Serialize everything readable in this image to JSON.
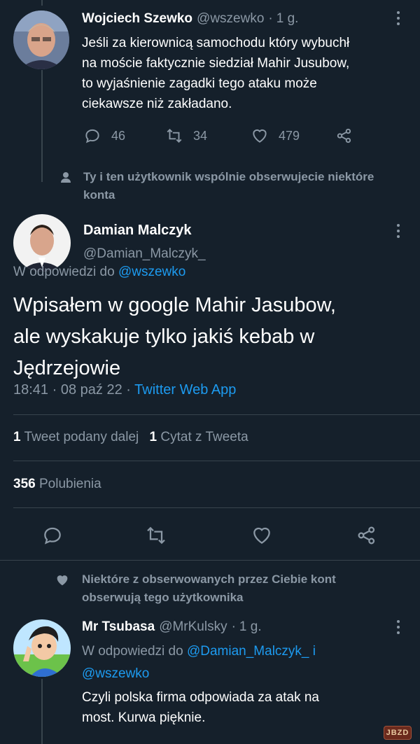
{
  "tweet1": {
    "author_name": "Wojciech Szewko",
    "handle": "@wszewko",
    "separator": "·",
    "time": "1 g.",
    "text_lines": [
      "Jeśli za kierownicą samochodu który wybuchł",
      "na moście faktycznie siedział Mahir Jusubow,",
      "to wyjaśnienie zagadki tego ataku może",
      "ciekawsze niż zakładano."
    ],
    "replies": "46",
    "retweets": "34",
    "likes": "479"
  },
  "social_context_1": {
    "line1": "Ty i ten użytkownik wspólnie obserwujecie niektóre",
    "line2": "konta"
  },
  "main_tweet": {
    "author_name": "Damian Malczyk",
    "handle": "@Damian_Malczyk_",
    "reply_prefix": "W odpowiedzi do",
    "reply_to": "@wszewko",
    "text_lines": [
      "Wpisałem w google Mahir Jasubow,",
      "ale wyskakuje tylko jakiś kebab w",
      "Jędrzejowie"
    ],
    "time": "18:41",
    "date": "08 paź 22",
    "dot": "·",
    "source": "Twitter Web App",
    "retweet_count": "1",
    "retweet_label": "Tweet podany dalej",
    "quote_count": "1",
    "quote_label": "Cytat z Tweeta",
    "like_count": "356",
    "like_label": "Polubienia"
  },
  "social_context_2": {
    "line1": "Niektóre z obserwowanych przez Ciebie kont",
    "line2": "obserwują tego użytkownika"
  },
  "tweet3": {
    "author_name": "Mr Tsubasa",
    "handle": "@MrKulsky",
    "separator": "·",
    "time": "1 g.",
    "reply_prefix": "W odpowiedzi do",
    "reply_to_1": "@Damian_Malczyk_",
    "reply_and": "i",
    "reply_to_2": "@wszewko",
    "text_lines": [
      "Czyli polska firma odpowiada za atak na",
      "most. Kurwa pięknie."
    ]
  },
  "watermark": "JBZD",
  "colors": {
    "background": "#15202b",
    "text": "#ffffff",
    "muted": "#8b98a5",
    "accent": "#1d9bf0",
    "divider": "#38444d"
  },
  "icons": {
    "reply": "reply-icon",
    "retweet": "retweet-icon",
    "like": "heart-icon",
    "share": "share-icon",
    "more": "more-vertical-icon",
    "person": "person-icon"
  }
}
